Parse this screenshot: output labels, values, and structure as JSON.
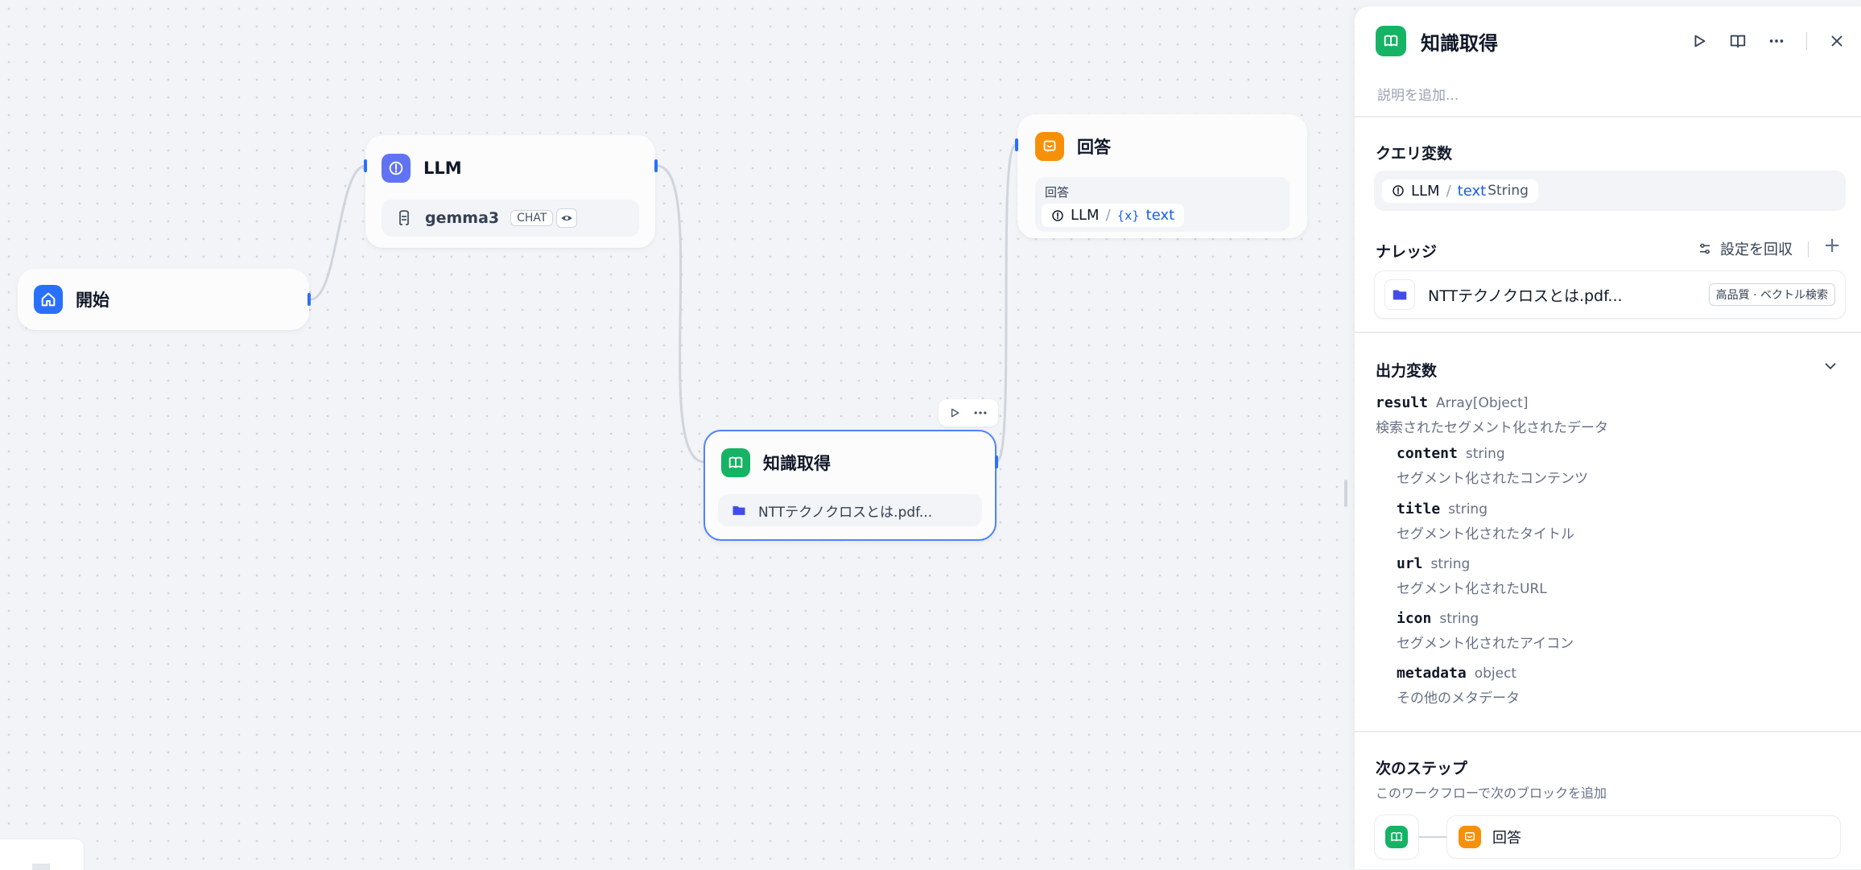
{
  "nodes": {
    "start": {
      "title": "開始"
    },
    "llm": {
      "title": "LLM",
      "model": "gemma3",
      "mode_tag": "CHAT"
    },
    "knowledge": {
      "title": "知識取得",
      "kb_name": "NTTテクノクロスとは.pdf..."
    },
    "answer": {
      "title": "回答",
      "field_label": "回答",
      "var_source": "LLM",
      "var_name": "text"
    }
  },
  "panel": {
    "title": "知識取得",
    "description_placeholder": "説明を追加...",
    "query_section": {
      "title": "クエリ変数",
      "source": "LLM",
      "var": "text",
      "type": "String"
    },
    "knowledge_section": {
      "title": "ナレッジ",
      "recall_label": "設定を回収",
      "add_label": "+",
      "item": {
        "name": "NTTテクノクロスとは.pdf...",
        "tag": "高品質 · ベクトル検索"
      }
    },
    "output_section": {
      "title": "出力変数",
      "result": {
        "name": "result",
        "type": "Array[Object]",
        "desc": "検索されたセグメント化されたデータ"
      },
      "fields": [
        {
          "name": "content",
          "type": "string",
          "desc": "セグメント化されたコンテンツ"
        },
        {
          "name": "title",
          "type": "string",
          "desc": "セグメント化されたタイトル"
        },
        {
          "name": "url",
          "type": "string",
          "desc": "セグメント化されたURL"
        },
        {
          "name": "icon",
          "type": "string",
          "desc": "セグメント化されたアイコン"
        },
        {
          "name": "metadata",
          "type": "object",
          "desc": "その他のメタデータ"
        }
      ]
    },
    "next_step": {
      "title": "次のステップ",
      "desc": "このワークフローで次のブロックを追加",
      "target": "回答"
    }
  },
  "colors": {
    "accent_blue": "#2970ff",
    "start_icon": "#2970ff",
    "llm_icon": "#6172f3",
    "knowledge_icon": "#16b364",
    "answer_icon": "#f79009",
    "folder": "#444ce7"
  },
  "icons": [
    "home-icon",
    "llm-icon",
    "model-icon",
    "eye-icon",
    "book-icon",
    "folder-icon",
    "answer-icon",
    "play-icon",
    "more-icon",
    "split-view-icon",
    "close-icon",
    "settings-icon",
    "chevron-down-icon",
    "variable-icon"
  ]
}
